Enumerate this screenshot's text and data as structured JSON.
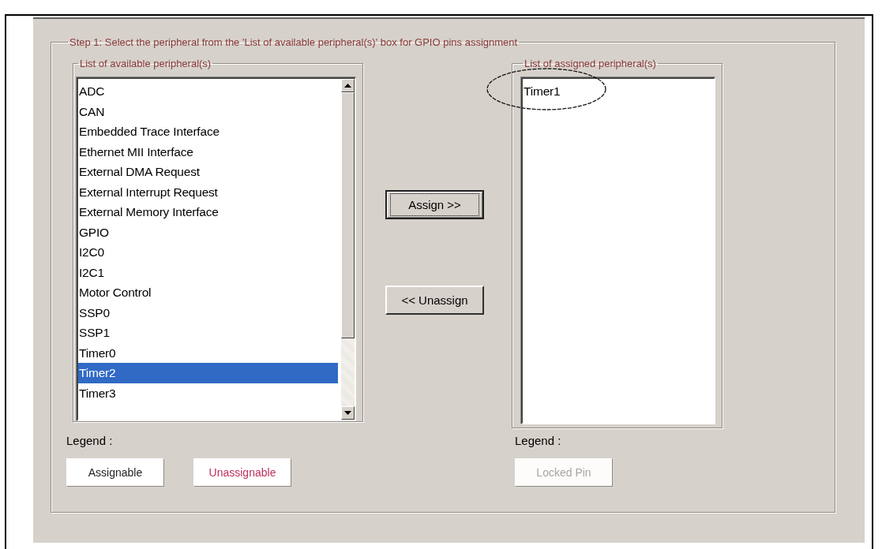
{
  "step_group": {
    "title": "Step 1: Select the peripheral from the 'List of available peripheral(s)' box for GPIO pins assignment"
  },
  "available": {
    "title": "List of available peripheral(s)",
    "items": [
      {
        "label": "ADC",
        "selected": false
      },
      {
        "label": "CAN",
        "selected": false
      },
      {
        "label": "Embedded Trace Interface",
        "selected": false
      },
      {
        "label": "Ethernet MII Interface",
        "selected": false
      },
      {
        "label": "External DMA Request",
        "selected": false
      },
      {
        "label": "External Interrupt Request",
        "selected": false
      },
      {
        "label": "External Memory Interface",
        "selected": false
      },
      {
        "label": "GPIO",
        "selected": false
      },
      {
        "label": "I2C0",
        "selected": false
      },
      {
        "label": "I2C1",
        "selected": false
      },
      {
        "label": "Motor Control",
        "selected": false
      },
      {
        "label": "SSP0",
        "selected": false
      },
      {
        "label": "SSP1",
        "selected": false
      },
      {
        "label": "Timer0",
        "selected": false
      },
      {
        "label": "Timer2",
        "selected": true
      },
      {
        "label": "Timer3",
        "selected": false
      }
    ]
  },
  "buttons": [
    {
      "label": "Assign >>",
      "focused": true
    },
    {
      "label": "<< Unassign",
      "focused": false
    }
  ],
  "assigned": {
    "title": "List of assigned peripheral(s)",
    "items": [
      {
        "label": "Timer1",
        "selected": false,
        "circled": true
      }
    ]
  },
  "legend_left": {
    "label": "Legend :",
    "items": [
      {
        "label": "Assignable",
        "kind": "assignable"
      },
      {
        "label": "Unassignable",
        "kind": "unassignable"
      }
    ]
  },
  "legend_right": {
    "label": "Legend :",
    "items": [
      {
        "label": "Locked Pin",
        "kind": "locked"
      }
    ]
  }
}
